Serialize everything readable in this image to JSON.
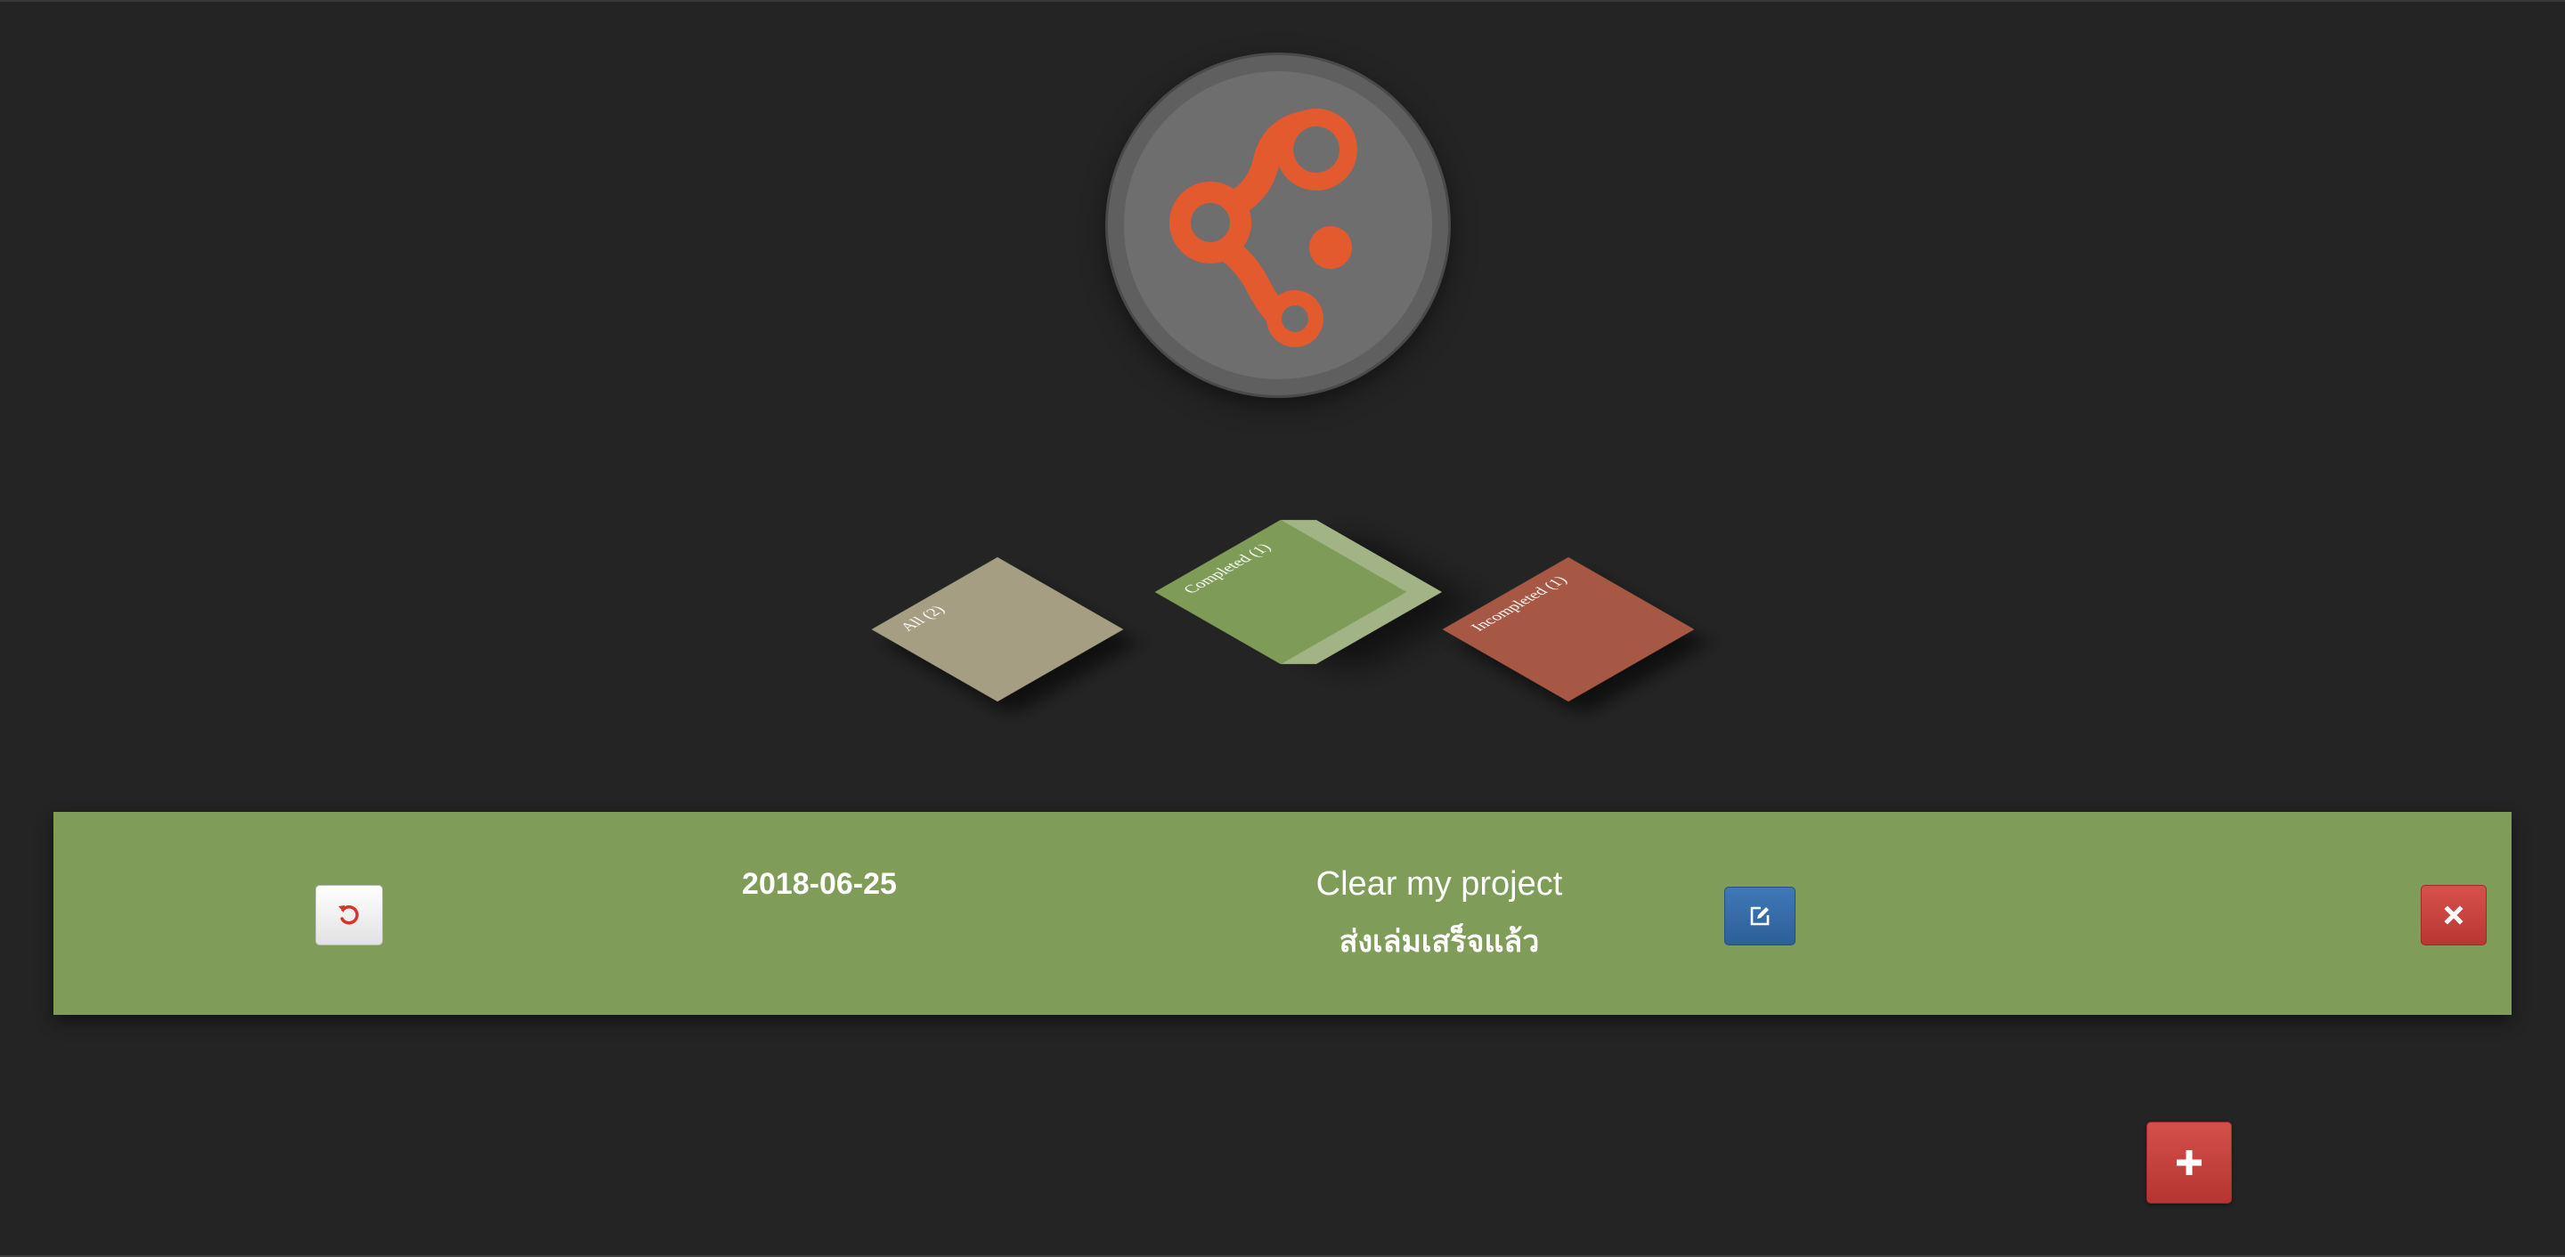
{
  "logo": {
    "icon": "molecule-logo-icon",
    "accent": "#e45a2f"
  },
  "filters": [
    {
      "label": "All (2)",
      "color": "#a69e82"
    },
    {
      "label": "Completed (1)",
      "color": "#7e9c57"
    },
    {
      "label": "Incompleted (1)",
      "color": "#a75845"
    }
  ],
  "todos": [
    {
      "date": "2018-06-25",
      "title": "Clear my project",
      "description": "ส่งเล่มเสร็จแล้ว",
      "status": "completed",
      "row_color": "#809c59",
      "actions": {
        "undo_icon": "undo-icon",
        "edit_icon": "edit-icon",
        "delete_icon": "close-icon"
      }
    }
  ],
  "add_button": {
    "icon": "plus-icon",
    "color": "#c9443f"
  }
}
